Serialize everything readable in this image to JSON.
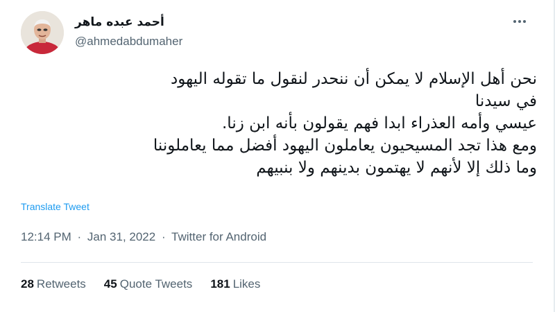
{
  "author": {
    "display_name": "أحمد عبده ماهر",
    "handle": "@ahmedabdumaher",
    "avatar_icon": "user-avatar"
  },
  "more_icon": "more-horizontal-icon",
  "tweet": {
    "lines": [
      "نحن أهل الإسلام لا يمكن أن ننحدر لنقول ما تقوله اليهود",
      "في سيدنا",
      "عيسي وأمه العذراء ابدا فهم يقولون بأنه ابن زنا.",
      "ومع هذا تجد المسيحيون يعاملون اليهود أفضل مما يعاملوننا",
      "وما ذلك إلا لأنهم لا يهتمون بدينهم ولا بنبيهم"
    ],
    "translate_label": "Translate Tweet"
  },
  "meta": {
    "time": "12:14 PM",
    "separator": "·",
    "date": "Jan 31, 2022",
    "source": "Twitter for Android"
  },
  "stats": {
    "retweets_count": "28",
    "retweets_label": "Retweets",
    "quotes_count": "45",
    "quotes_label": "Quote Tweets",
    "likes_count": "181",
    "likes_label": "Likes"
  },
  "colors": {
    "link": "#1d9bf0",
    "secondary_text": "#536471",
    "primary_text": "#0f1419"
  }
}
